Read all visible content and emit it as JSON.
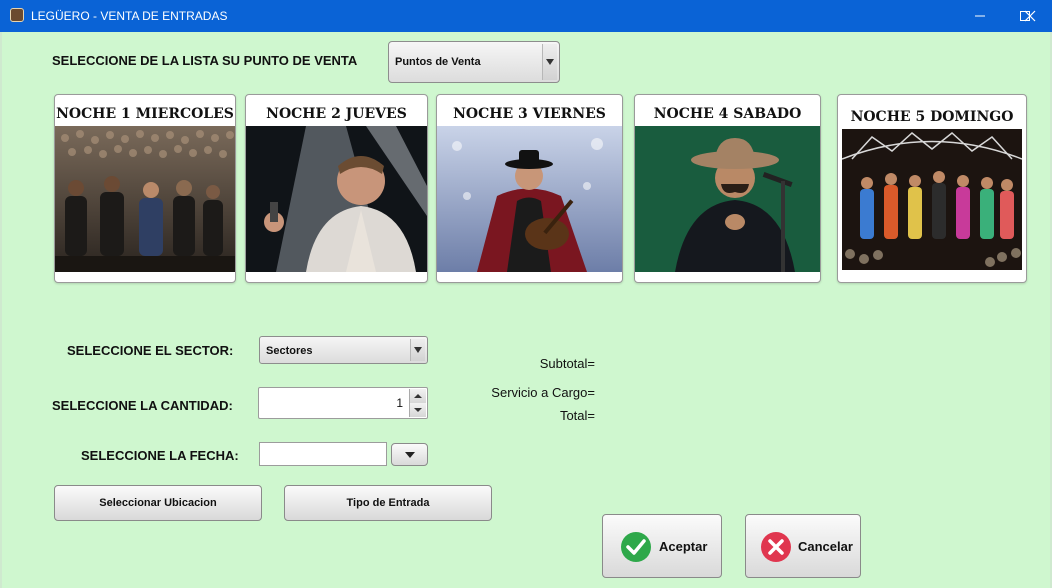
{
  "window": {
    "title": "LEGÜERO - VENTA DE ENTRADAS"
  },
  "pos": {
    "label": "SELECCIONE DE LA LISTA SU PUNTO DE VENTA",
    "selected": "Puntos de Venta"
  },
  "nights": [
    {
      "label": "NOCHE 1 MIERCOLES"
    },
    {
      "label": "NOCHE 2 JUEVES"
    },
    {
      "label": "NOCHE 3 VIERNES"
    },
    {
      "label": "NOCHE 4 SABADO"
    },
    {
      "label": "NOCHE 5 DOMINGO"
    }
  ],
  "form": {
    "sector_label": "SELECCIONE EL SECTOR:",
    "sector_selected": "Sectores",
    "quantity_label": "SELECCIONE LA CANTIDAD:",
    "quantity_value": "1",
    "date_label": "SELECCIONE LA FECHA:",
    "date_value": ""
  },
  "buttons": {
    "select_location": "Seleccionar Ubicacion",
    "ticket_type": "Tipo de Entrada",
    "accept": "Aceptar",
    "cancel": "Cancelar"
  },
  "totals": {
    "subtotal_label": "Subtotal=",
    "service_label": "Servicio a Cargo=",
    "total_label": "Total="
  },
  "colors": {
    "titlebar": "#0a63d6",
    "background": "#cff7cf",
    "accept_icon": "#2ea84a",
    "cancel_icon": "#e0364f"
  }
}
